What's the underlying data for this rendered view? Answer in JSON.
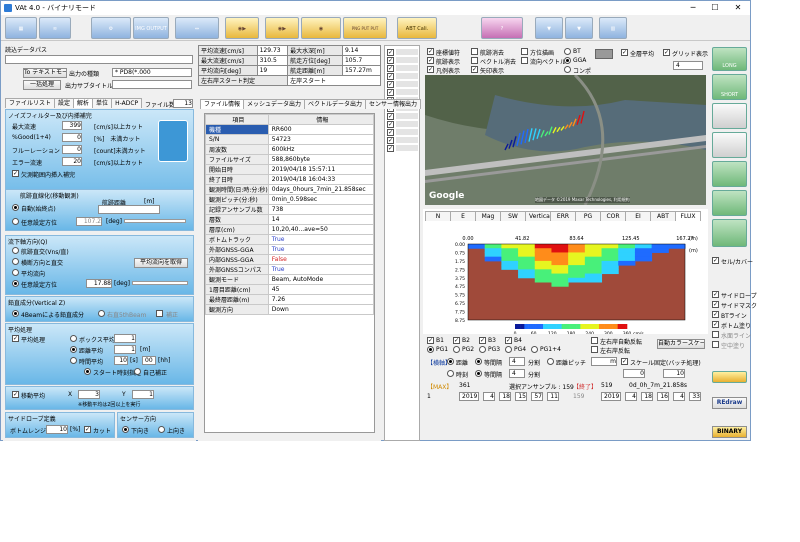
{
  "title": "VAt 4.0 - バイナリモード",
  "toolbar": {
    "buttons": [
      "",
      "",
      "",
      "IMG OUTPUT",
      "",
      "",
      "",
      "PNG PUT PUT",
      "ABT Cali.",
      "",
      "",
      "",
      "",
      ""
    ]
  },
  "left": {
    "read_path_label": "読込データパス",
    "to_text_btn": "To テキストモード",
    "output_type_label": "出力の種類",
    "output_type_value": "* PD8(*.000",
    "batch_btn": "一括処理",
    "output_subtitle": "出力サブタイトル",
    "tabs": [
      "ファイルリスト",
      "設定",
      "解析",
      "単位",
      "H-ADCP"
    ],
    "file_count_label": "ファイル数",
    "file_count": "13",
    "noise_title": "ノイズフィルター及び内挿補完",
    "max_velocity_label": "最大流速",
    "max_velocity": "399",
    "max_velocity_unit": "[cm/s]以上カット",
    "good_label": "%Good(1+4)",
    "good_value": "0",
    "good_unit": "[%]　未満カット",
    "fluorescence_label": "フルーレーション",
    "fluorescence_value": "0",
    "fluorescence_unit": "[count]未満カット",
    "error_label": "エラー流速",
    "error_value": "20",
    "error_unit": "[cm/s]以上カット",
    "interp_label": "欠測範囲内挿入補完",
    "track_title": "航跡直線化(移動観測)",
    "auto_label": "自動(始終点)",
    "manual_label": "任意設定方位",
    "manual_value": "107.2",
    "manual_unit": "[deg]",
    "track_dist_label": "航跡距離",
    "track_dist_unit": "[m]",
    "flow_dir_title": "流下軸方向(Q)",
    "flow_opt1": "航跡直交(Vns/直)",
    "flow_opt2": "横断方向と直交",
    "flow_opt3": "平均流向",
    "flow_opt4": "任意設定方位",
    "flow_btn": "平均流向を取得",
    "flow_value": "17.88",
    "flow_unit": "[deg]",
    "vertical_title": "鉛直成分(Vertical Z)",
    "vertical_opt1": "4Beamによる鉛直成分",
    "vertical_opt2": "右直5thBeam",
    "vertical_opt3": "補正",
    "avg_title": "平均処理",
    "avg_check": "平均処理",
    "avg_box": "ボックス平均",
    "avg_dist": "距離平均",
    "avg_time": "時間平均",
    "avg_box_val": "1",
    "avg_dist_val": "1",
    "avg_dist_unit": "[m]",
    "avg_time_val": "10",
    "avg_time_unit": "[s]",
    "avg_time_val2": "00",
    "avg_time_unit2": "[hh]",
    "start_time": "スタート時刻指定",
    "auto_fix": "自己補正",
    "move_avg": "移動平均",
    "move_x_label": "X",
    "move_x": "3",
    "move_y_label": "Y",
    "move_y": "1",
    "move_note": "※移動平均は2回以上を実行",
    "sidelobe_title": "サイドローブ定義",
    "sidelobe_label": "ボトムレンジ",
    "sidelobe_value": "10",
    "sidelobe_unit": "[%]",
    "sidelobe_cut": "カット",
    "sensor_title": "センサー方向",
    "sensor_down": "下向き",
    "sensor_up": "上向き"
  },
  "summary": {
    "rows": [
      [
        "平均流速[cm/s]",
        "129.73",
        "最大水深[m]",
        "9.14"
      ],
      [
        "最大流速[cm/s]",
        "310.5",
        "航走方位[deg]",
        "105.7"
      ],
      [
        "平均流向[deg]",
        "19",
        "航走距離[m]",
        "157.27m"
      ]
    ],
    "footer_left": "左右岸スタート判定",
    "footer_right": "左岸スタート"
  },
  "info": {
    "tabs": [
      "ファイル情報",
      "メッシュデータ出力",
      "ベクトルデータ出力",
      "センサー情報出力"
    ],
    "header": [
      "項目",
      "情報"
    ],
    "rows": [
      [
        "機種",
        "RR600"
      ],
      [
        "S/N",
        "54723"
      ],
      [
        "周波数",
        "600kHz"
      ],
      [
        "ファイルサイズ",
        "588,860byte"
      ],
      [
        "開始日時",
        "2019/04/18 15:57:11"
      ],
      [
        "終了日時",
        "2019/04/18 16:04:33"
      ],
      [
        "観測時間(日:時:分:秒)",
        "0days_0hours_7min_21.858sec"
      ],
      [
        "観測ピッチ(分:秒)",
        "0min_0.598sec"
      ],
      [
        "記録アンサンブル数",
        "738"
      ],
      [
        "層数",
        "14"
      ],
      [
        "層厚(cm)",
        "10,20,40...ave=50"
      ],
      [
        "ボトムトラック",
        "True"
      ],
      [
        "外部GNSS-GGA",
        "True"
      ],
      [
        "内部GNSS-GGA",
        "False"
      ],
      [
        "外部GNSSコンパス",
        "True"
      ],
      [
        "観測モード",
        "Beam, AutoMode"
      ],
      [
        "1層目距離(cm)",
        "45"
      ],
      [
        "最終層距離(m)",
        "7.26"
      ],
      [
        "観測方向",
        "Down"
      ]
    ],
    "true_color": "#2a3ec8",
    "false_color": "#d62020"
  },
  "map": {
    "checks": [
      "座標値符",
      "航跡表示",
      "凡例表示",
      "航跡消去",
      "ベクトル消去",
      "矢印表示",
      "方位描画",
      "流向ベクトル"
    ],
    "radio": [
      "BT",
      "GGA",
      "コンポ"
    ],
    "overall_avg": "全層平均",
    "grid": "グリッド表示",
    "layer": "4",
    "google": "Google",
    "attribution": "地図データ ©2019 Maxar Technologies, 利用規約"
  },
  "chart_tabs": [
    "N",
    "E",
    "Mag",
    "SW",
    "Vertical",
    "ERR",
    "PG",
    "COR",
    "EI",
    "ABT",
    "FLUX"
  ],
  "chart_data": {
    "type": "heatmap",
    "x_ticks": [
      "0.00",
      "41.82",
      "83.64",
      "125.45",
      "167.27"
    ],
    "y_ticks": [
      "0.00",
      "0.75",
      "1.75",
      "2.75",
      "3.75",
      "4.75",
      "5.75",
      "6.75",
      "7.75",
      "8.75"
    ],
    "y_unit": "(m)",
    "x_unit": "(m)",
    "colorbar_ticks": [
      "0",
      "60",
      "120",
      "180",
      "240",
      "300",
      "360"
    ],
    "colorbar_unit": "cm/s",
    "colors": [
      "#0a1a9a",
      "#1f6bff",
      "#2fd2ff",
      "#48f07a",
      "#e6f520",
      "#ff8c1a",
      "#e01010"
    ],
    "depth_profile": [
      0.6,
      2.2,
      3.0,
      3.8,
      4.4,
      4.8,
      4.6,
      4.3,
      3.6,
      2.6,
      1.8,
      1.2,
      0.6
    ],
    "core_velocity": [
      80,
      150,
      220,
      260,
      340,
      360,
      300,
      260,
      220,
      160,
      100,
      80,
      60
    ]
  },
  "bottom": {
    "beams": [
      "B1",
      "B2",
      "B3",
      "B4"
    ],
    "pg": [
      "PG1",
      "PG2",
      "PG3",
      "PG4",
      "PG1+4"
    ],
    "left_right_label": "左右岸自動反転",
    "left_right_label2": "左右岸反転",
    "auto_scale": "自動カラースケール",
    "mode_label": "【横軸】",
    "dist": "距離",
    "equal": "等間隔",
    "div_label": "分割",
    "dist_pitch": "距離ピッチ",
    "time": "時刻",
    "div_val": "4",
    "pitch_val": "m",
    "scale_fixed": "スケール固定(バッチ処理)",
    "scale_val": "0",
    "scale_val2": "10"
  },
  "status": {
    "vmax_label": "【MAX】",
    "vmax": "1",
    "ens_total": "361",
    "sel_label": "選択アンサンブル : 159",
    "end_label": "【終了】",
    "ens_end": "519",
    "elapsed": "0d_0h_7m_21.858s",
    "start_y": "2019",
    "start_m": "4",
    "start_d": "18",
    "start_h": "15",
    "start_min": "57",
    "start_s": "11",
    "ens_mid": "159",
    "end_y": "2019",
    "end_m": "4",
    "end_d": "18",
    "end_h": "16",
    "end_min": "4",
    "end_s": "33"
  },
  "right": {
    "long": "LONG",
    "short": "SHORT",
    "sidebar": "セル/カバー",
    "checks": [
      "サイドロープ",
      "サイドマスク",
      "BTライン",
      "ボトム塗り",
      "水面ライン",
      "空中塗り"
    ],
    "redraw": "REdraw",
    "binary": "BINARY"
  }
}
